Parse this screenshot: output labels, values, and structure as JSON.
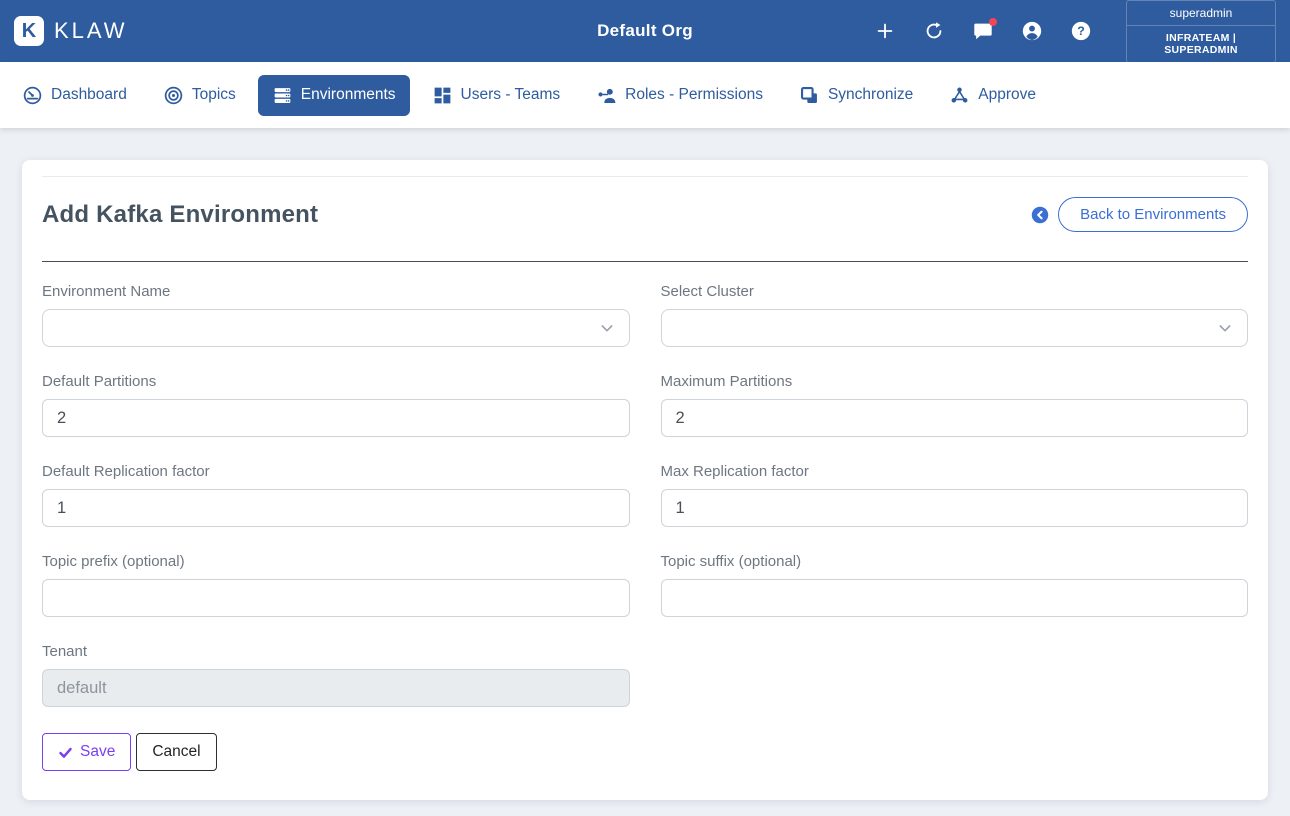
{
  "header": {
    "brand": "KLAW",
    "logo_letter": "K",
    "org_title": "Default Org",
    "user": {
      "name": "superadmin",
      "team_role": "INFRATEAM | SUPERADMIN"
    }
  },
  "nav": {
    "items": [
      {
        "label": "Dashboard",
        "active": false
      },
      {
        "label": "Topics",
        "active": false
      },
      {
        "label": "Environments",
        "active": true
      },
      {
        "label": "Users - Teams",
        "active": false
      },
      {
        "label": "Roles - Permissions",
        "active": false
      },
      {
        "label": "Synchronize",
        "active": false
      },
      {
        "label": "Approve",
        "active": false
      }
    ]
  },
  "main": {
    "title": "Add Kafka Environment",
    "back_button_label": "Back to Environments",
    "form": {
      "fields": [
        {
          "label": "Environment Name",
          "type": "select",
          "value": ""
        },
        {
          "label": "Select Cluster",
          "type": "select",
          "value": ""
        },
        {
          "label": "Default Partitions",
          "type": "text",
          "value": "2"
        },
        {
          "label": "Maximum Partitions",
          "type": "text",
          "value": "2"
        },
        {
          "label": "Default Replication factor",
          "type": "text",
          "value": "1"
        },
        {
          "label": "Max Replication factor",
          "type": "text",
          "value": "1"
        },
        {
          "label": "Topic prefix (optional)",
          "type": "text",
          "value": ""
        },
        {
          "label": "Topic suffix (optional)",
          "type": "text",
          "value": ""
        },
        {
          "label": "Tenant",
          "type": "text",
          "value": "default",
          "disabled": true
        }
      ],
      "save_label": "Save",
      "cancel_label": "Cancel"
    }
  },
  "colors": {
    "header_blue": "#2e5c9e",
    "accent_blue": "#3b6fd4",
    "save_purple": "#7b3ff2",
    "notification_red": "#f2455a",
    "page_background": "#edf0f5"
  }
}
